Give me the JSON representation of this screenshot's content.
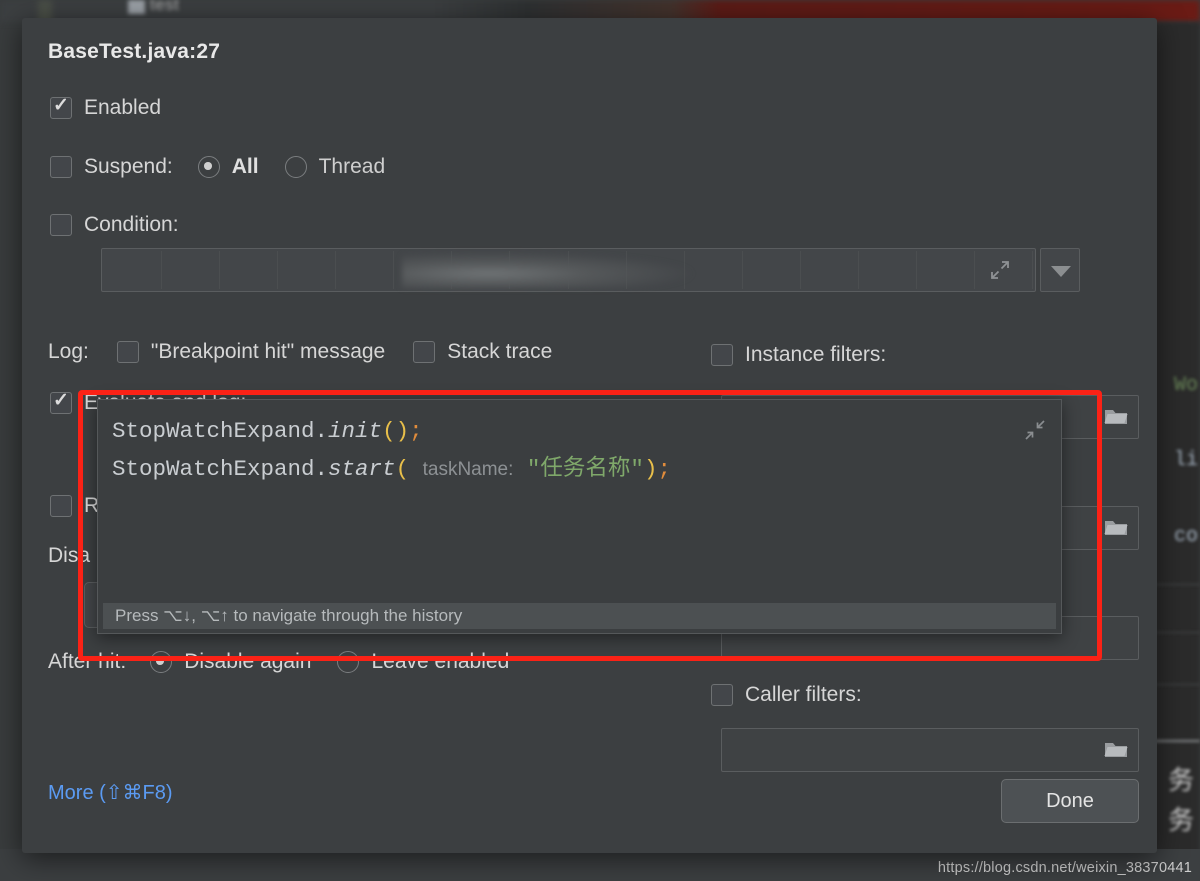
{
  "background": {
    "tab_label": "test",
    "right_fragments": [
      "Wo",
      "li",
      "co",
      "务",
      "务"
    ],
    "watermark": "https://blog.csdn.net/weixin_38370441"
  },
  "dialog": {
    "title": "BaseTest.java:27",
    "enabled": {
      "label": "Enabled",
      "checked": true
    },
    "suspend": {
      "label": "Suspend:",
      "checked": false,
      "options": [
        {
          "label": "All",
          "selected": true
        },
        {
          "label": "Thread",
          "selected": false
        }
      ]
    },
    "condition": {
      "label": "Condition:",
      "checked": false,
      "value": "",
      "expand_icon": "expand-arrows-icon",
      "dropdown_icon": "chevron-down-icon"
    },
    "log": {
      "label": "Log:",
      "breakpoint_hit": {
        "label": "\"Breakpoint hit\" message",
        "checked": false
      },
      "stack_trace": {
        "label": "Stack trace",
        "checked": false
      }
    },
    "evaluate_and_log": {
      "label": "Evaluate and log:",
      "checked": true
    },
    "remove_once_hit": {
      "label": "R",
      "checked": false
    },
    "disable_until": {
      "label": "Disa",
      "value": "<"
    },
    "after_hit": {
      "label": "After hit:",
      "options": [
        {
          "label": "Disable again",
          "selected": true
        },
        {
          "label": "Leave enabled",
          "selected": false
        }
      ]
    },
    "instance_filters": {
      "label": "Instance filters:",
      "checked": false,
      "value": "",
      "browse_icon": "folder-icon"
    },
    "class_filters": {
      "value": "",
      "browse_icon": "folder-icon"
    },
    "pass_count": {
      "value": ""
    },
    "caller_filters": {
      "label": "Caller filters:",
      "checked": false,
      "value": "",
      "browse_icon": "folder-icon"
    },
    "more_link": "More (⇧⌘F8)",
    "done_button": "Done"
  },
  "code_popup": {
    "line1": {
      "class": "StopWatchExpand.",
      "method": "init",
      "paren_open": "(",
      "paren_close": ")",
      "semicolon": ";"
    },
    "line2": {
      "class": "StopWatchExpand.",
      "method": "start",
      "paren_open": "(",
      "param_hint": "taskName:",
      "string": "\"任务名称\"",
      "paren_close": ")",
      "semicolon": ";"
    },
    "history_hint": "Press ⌥↓, ⌥↑ to navigate through the history",
    "collapse_icon": "collapse-arrows-icon"
  },
  "colors": {
    "dialog_bg": "#3c3f41",
    "highlight_outline": "#fb2216",
    "link_blue": "#5b9bf3",
    "string_green": "#7fa86a",
    "paren_yellow": "#e8bf4a",
    "semicolon_orange": "#e08c3c"
  }
}
